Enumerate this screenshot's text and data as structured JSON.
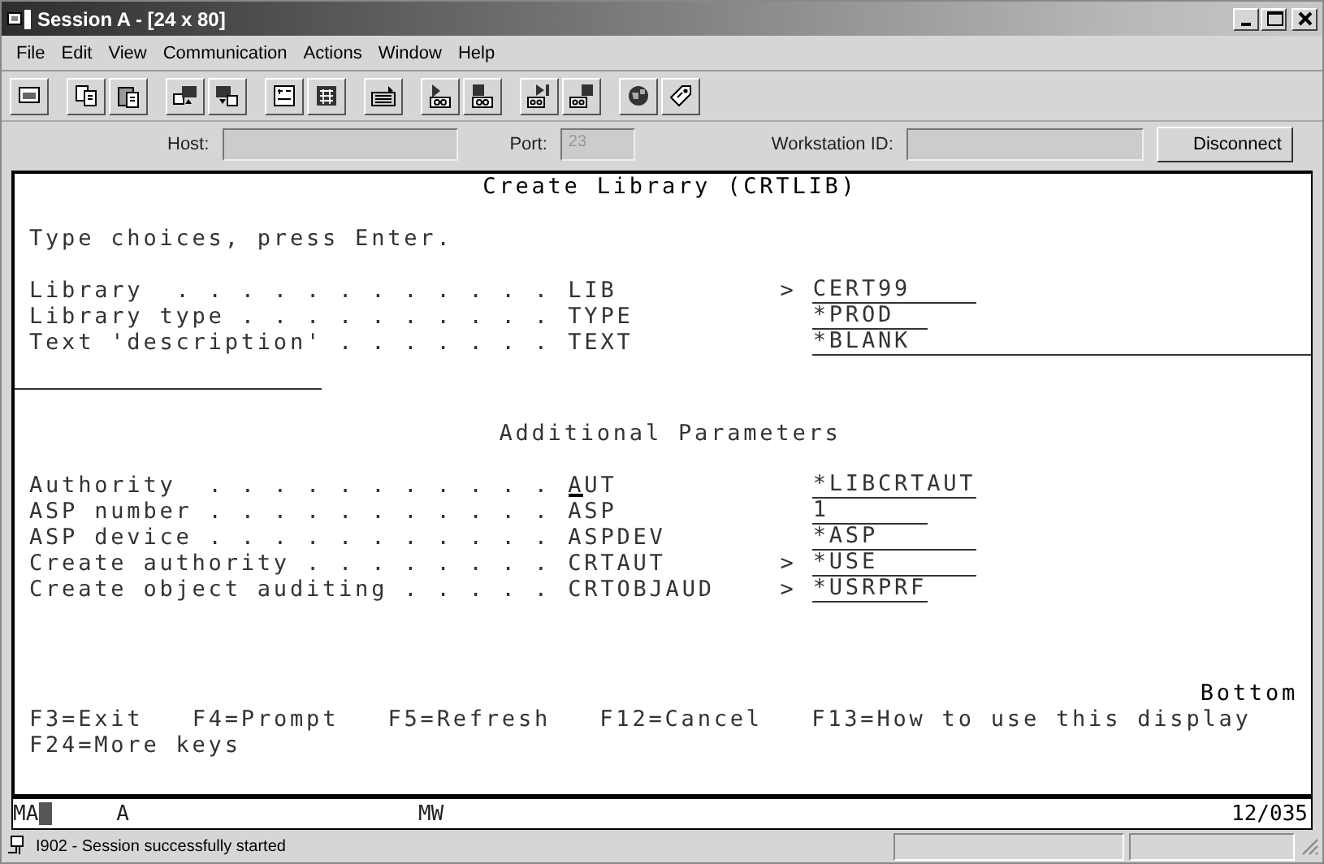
{
  "window": {
    "title": "Session A - [24 x 80]"
  },
  "menu": [
    "File",
    "Edit",
    "View",
    "Communication",
    "Actions",
    "Window",
    "Help"
  ],
  "connection": {
    "host_label": "Host:",
    "port_label": "Port:",
    "port_value": "23",
    "port_disabled": true,
    "workstation_label": "Workstation ID:",
    "disconnect_button": "Disconnect"
  },
  "screen": {
    "title": "Create Library (CRTLIB)",
    "instruction": "Type choices, press Enter.",
    "parameters": [
      {
        "label": "Library  . . . . . . . . . . . .",
        "keyword": "LIB",
        "marker": ">",
        "value": "CERT99",
        "kind": "name",
        "cursor": false
      },
      {
        "label": "Library type . . . . . . . . . .",
        "keyword": "TYPE",
        "value": "*PROD",
        "kind": "short",
        "cursor": false
      },
      {
        "label": "Text 'description' . . . . . . .",
        "keyword": "TEXT",
        "value": "*BLANK",
        "kind": "text",
        "cursor": false
      }
    ],
    "section_title": "Additional Parameters",
    "additional_parameters": [
      {
        "label": "Authority  . . . . . . . . . . .",
        "keyword": "AUT",
        "value": "*LIBCRTAUT",
        "kind": "name",
        "cursor": true
      },
      {
        "label": "ASP number . . . . . . . . . . .",
        "keyword": "ASP",
        "value": "1",
        "kind": "number",
        "cursor": false
      },
      {
        "label": "ASP device . . . . . . . . . . .",
        "keyword": "ASPDEV",
        "value": "*ASP",
        "kind": "name",
        "cursor": false
      },
      {
        "label": "Create authority . . . . . . . .",
        "keyword": "CRTAUT",
        "marker": ">",
        "value": "*USE",
        "kind": "name",
        "cursor": false
      },
      {
        "label": "Create object auditing . . . . .",
        "keyword": "CRTOBJAUD",
        "marker": ">",
        "value": "*USRPRF",
        "kind": "number",
        "cursor": false
      }
    ],
    "more_indicator": "Bottom",
    "function_keys": [
      [
        "F3=Exit",
        "F4=Prompt",
        "F5=Refresh",
        "F12=Cancel",
        "F13=How to use this display"
      ],
      [
        "F24=More keys"
      ]
    ]
  },
  "indicator_line": {
    "mode": "MA",
    "field": "A",
    "code": "MW",
    "position": "12/035"
  },
  "status_bar": {
    "message": "I902 - Session successfully started"
  }
}
